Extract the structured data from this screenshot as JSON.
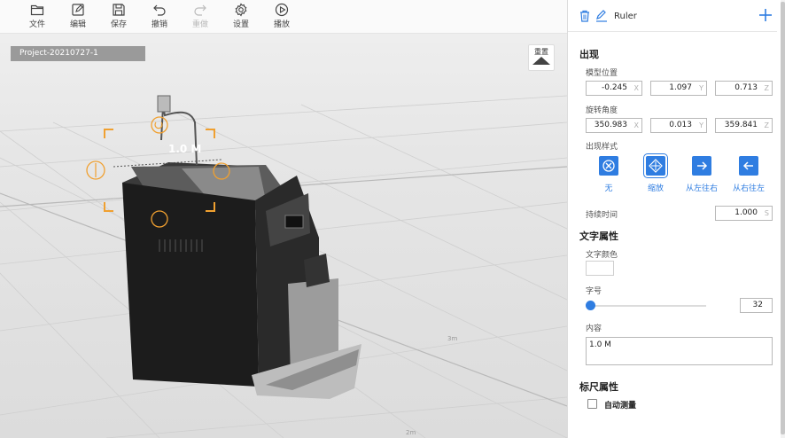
{
  "toolbar": {
    "file": "文件",
    "edit": "编辑",
    "save": "保存",
    "undo": "撤销",
    "redo": "重做",
    "settings": "设置",
    "play": "播放"
  },
  "viewport": {
    "project_name": "Project-20210727-1",
    "reset_label": "重置",
    "ruler_value": "1.0 M",
    "floor_labels": [
      "3m",
      "2m"
    ]
  },
  "panel": {
    "title": "Ruler",
    "appearance": {
      "section": "出现",
      "position_label": "模型位置",
      "position": {
        "x": "-0.245",
        "y": "1.097",
        "z": "0.713"
      },
      "rotation_label": "旋转角度",
      "rotation": {
        "x": "350.983",
        "y": "0.013",
        "z": "359.841"
      },
      "axis_x": "X",
      "axis_y": "Y",
      "axis_z": "Z",
      "style_label": "出现样式",
      "styles": [
        "无",
        "缩放",
        "从左往右",
        "从右往左"
      ],
      "selected_style": "缩放",
      "duration_label": "持续时间",
      "duration": "1.000",
      "duration_unit": "S"
    },
    "text_props": {
      "section": "文字属性",
      "color_label": "文字颜色",
      "color": "#ffffff",
      "size_label": "字号",
      "size": "32",
      "size_level": 0,
      "content_label": "内容",
      "content": "1.0 M"
    },
    "ruler_props": {
      "section": "标尺属性",
      "auto_measure": "自动测量",
      "auto_measure_checked": false
    }
  },
  "colors": {
    "accent": "#2f7de1",
    "gizmo": "#f0a030"
  }
}
